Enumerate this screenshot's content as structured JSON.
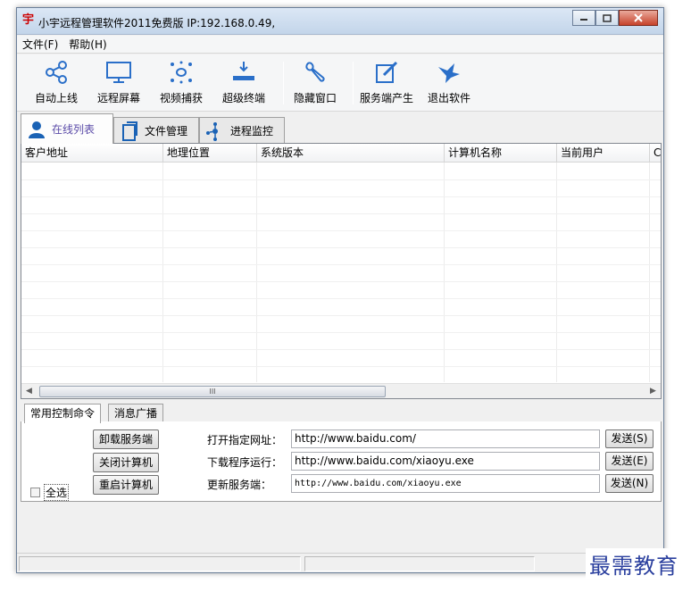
{
  "window": {
    "title": "小宇远程管理软件2011免费版 IP:192.168.0.49,",
    "app_icon_glyph": "宇"
  },
  "menu": [
    "文件(F)",
    "帮助(H)"
  ],
  "toolbar": [
    {
      "label": "自动上线",
      "icon": "share-nodes-icon"
    },
    {
      "label": "远程屏幕",
      "icon": "monitor-icon"
    },
    {
      "label": "视频捕获",
      "icon": "video-capture-icon"
    },
    {
      "label": "超级终端",
      "icon": "terminal-download-icon"
    },
    {
      "label": "隐藏窗口",
      "icon": "wrench-icon"
    },
    {
      "label": "服务端产生",
      "icon": "edit-icon"
    },
    {
      "label": "退出软件",
      "icon": "bird-icon"
    }
  ],
  "top_tabs": [
    {
      "label": "在线列表",
      "icon": "user-icon",
      "active": true
    },
    {
      "label": "文件管理",
      "icon": "document-icon",
      "active": false
    },
    {
      "label": "进程监控",
      "icon": "process-icon",
      "active": false
    }
  ],
  "list": {
    "columns": [
      "客户地址",
      "地理位置",
      "系统版本",
      "计算机名称",
      "当前用户",
      "C"
    ],
    "rows": []
  },
  "scrollbar": {
    "thumb_grip": "III"
  },
  "bottom_tabs": [
    {
      "label": "常用控制命令",
      "active": true
    },
    {
      "label": "消息广播",
      "active": false
    }
  ],
  "commands": {
    "uninstall_btn": "卸载服务端",
    "shutdown_btn": "关闭计算机",
    "restart_btn": "重启计算机",
    "select_all": "全选",
    "open_url_label": "打开指定网址：",
    "open_url_value": "http://www.baidu.com/",
    "download_label": "下载程序运行：",
    "download_value": "http://www.baidu.com/xiaoyu.exe",
    "update_label": "更新服务端：",
    "update_value": "http://www.baidu.com/xiaoyu.exe",
    "send_s": "发送(S)",
    "send_e": "发送(E)",
    "send_n": "发送(N)"
  },
  "watermark": "最需教育",
  "colors": {
    "accent": "#1a62b5",
    "tab_label_active": "#5a4aa8"
  }
}
